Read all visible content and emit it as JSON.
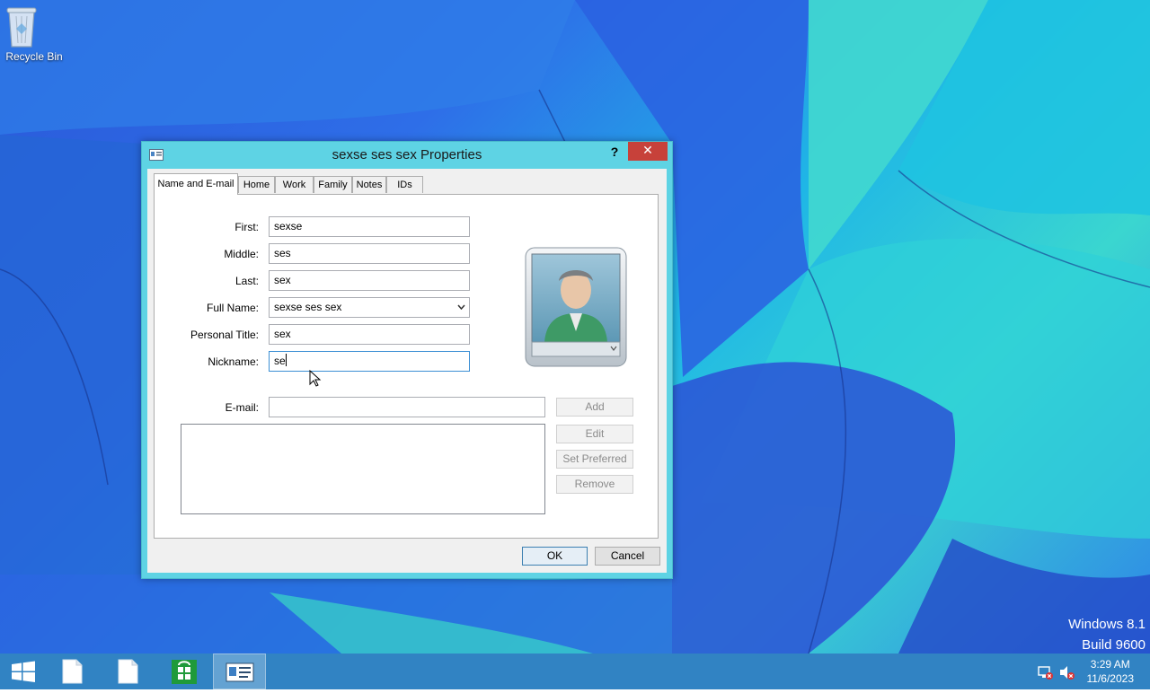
{
  "desktop": {
    "recycle_bin_label": "Recycle Bin",
    "watermark_line1": "Windows 8.1",
    "watermark_line2": "Build 9600"
  },
  "dialog": {
    "title": "sexse ses sex Properties",
    "help_glyph": "?",
    "close_glyph": "✕",
    "tabs": [
      {
        "label": "Name and E-mail",
        "active": true
      },
      {
        "label": "Home",
        "active": false
      },
      {
        "label": "Work",
        "active": false
      },
      {
        "label": "Family",
        "active": false
      },
      {
        "label": "Notes",
        "active": false
      },
      {
        "label": "IDs",
        "active": false
      }
    ],
    "fields": {
      "first_label": "First:",
      "first_value": "sexse",
      "middle_label": "Middle:",
      "middle_value": "ses",
      "last_label": "Last:",
      "last_value": "sex",
      "fullname_label": "Full Name:",
      "fullname_value": "sexse ses sex",
      "title_label": "Personal Title:",
      "title_value": "sex",
      "nickname_label": "Nickname:",
      "nickname_value": "se",
      "email_label": "E-mail:",
      "email_value": ""
    },
    "email_buttons": {
      "add": "Add",
      "edit": "Edit",
      "set_preferred": "Set Preferred",
      "remove": "Remove"
    },
    "ok": "OK",
    "cancel": "Cancel"
  },
  "taskbar": {
    "time": "3:29 AM",
    "date": "11/6/2023"
  },
  "colors": {
    "close_red": "#c7413a",
    "title_bar": "#5ed3e4",
    "taskbar": "#2078be"
  }
}
